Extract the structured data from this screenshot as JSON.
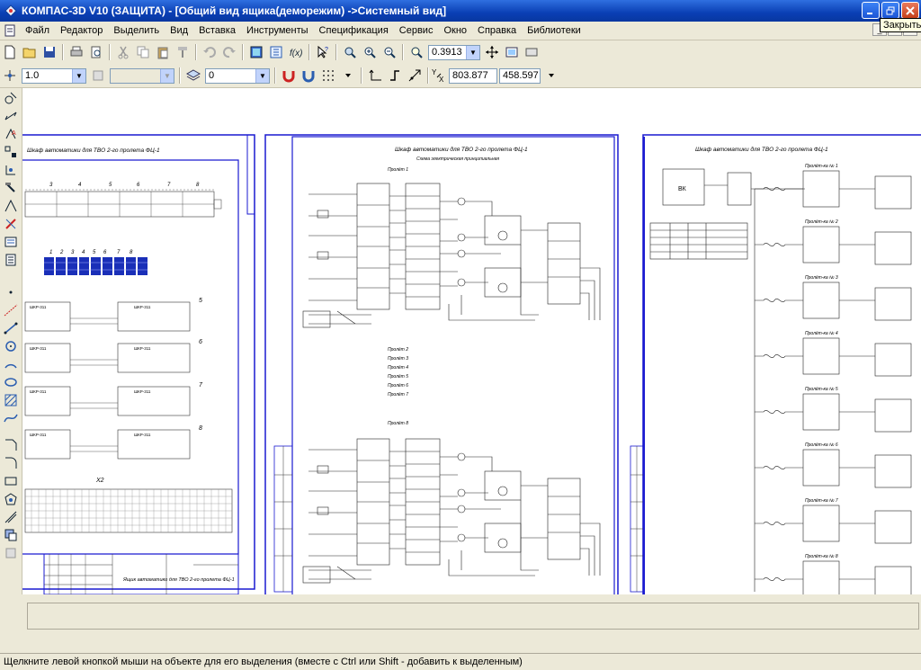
{
  "window": {
    "title": "КОМПАС-3D V10 (ЗАЩИТА) - [Общий вид ящика(деморежим) ->Системный вид]",
    "close_tooltip": "Закрыть"
  },
  "menu": {
    "items": [
      "Файл",
      "Редактор",
      "Выделить",
      "Вид",
      "Вставка",
      "Инструменты",
      "Спецификация",
      "Сервис",
      "Окно",
      "Справка",
      "Библиотеки"
    ]
  },
  "toolbar": {
    "zoom_value": "0.3913"
  },
  "props": {
    "line_scale": "1.0",
    "layer_combo": "",
    "layer_number": "0",
    "cursor_x": "803.877",
    "cursor_y": "458.597"
  },
  "drawing": {
    "sheet1_title": "Шкаф автоматики для ТВО 2-го пролета ФЦ-1",
    "sheet1_cols": [
      "3",
      "4",
      "5",
      "6",
      "7",
      "8"
    ],
    "sheet1_blocks": [
      "1",
      "2",
      "3",
      "4",
      "5",
      "6",
      "7",
      "8"
    ],
    "sheet1_rows": [
      "5",
      "6",
      "7",
      "8"
    ],
    "sheet1_device": "ШКР-311",
    "sheet1_connector": "Х2",
    "sheet1_stamp": "Ящик автоматики для ТВО 2-го пролета ФЦ-1",
    "sheet2_title": "Шкаф автоматики для ТВО 2-го пролета ФЦ-1",
    "sheet2_subtitle": "Схема электрическая принципиальная",
    "sheet2_block1": "Пролёт 1",
    "sheet2_block_list": [
      "Пролёт 2",
      "Пролёт 3",
      "Пролёт 4",
      "Пролёт 5",
      "Пролёт 6",
      "Пролёт 7"
    ],
    "sheet2_block8": "Пролёт 8",
    "sheet3_title": "Шкаф автоматики для ТВО 2-го пролета ФЦ-1",
    "sheet3_box": "ВК",
    "sheet3_sections": [
      "Пролёт-ка № 1",
      "Пролёт-ка № 2",
      "Пролёт-ка № 3",
      "Пролёт-ка № 4",
      "Пролёт-ка № 5",
      "Пролёт-ка № 6",
      "Пролёт-ка № 7",
      "Пролёт-ка № 8"
    ]
  },
  "status": {
    "hint": "Щелкните левой кнопкой мыши на объекте для его выделения (вместе с Ctrl или Shift - добавить к выделенным)"
  }
}
